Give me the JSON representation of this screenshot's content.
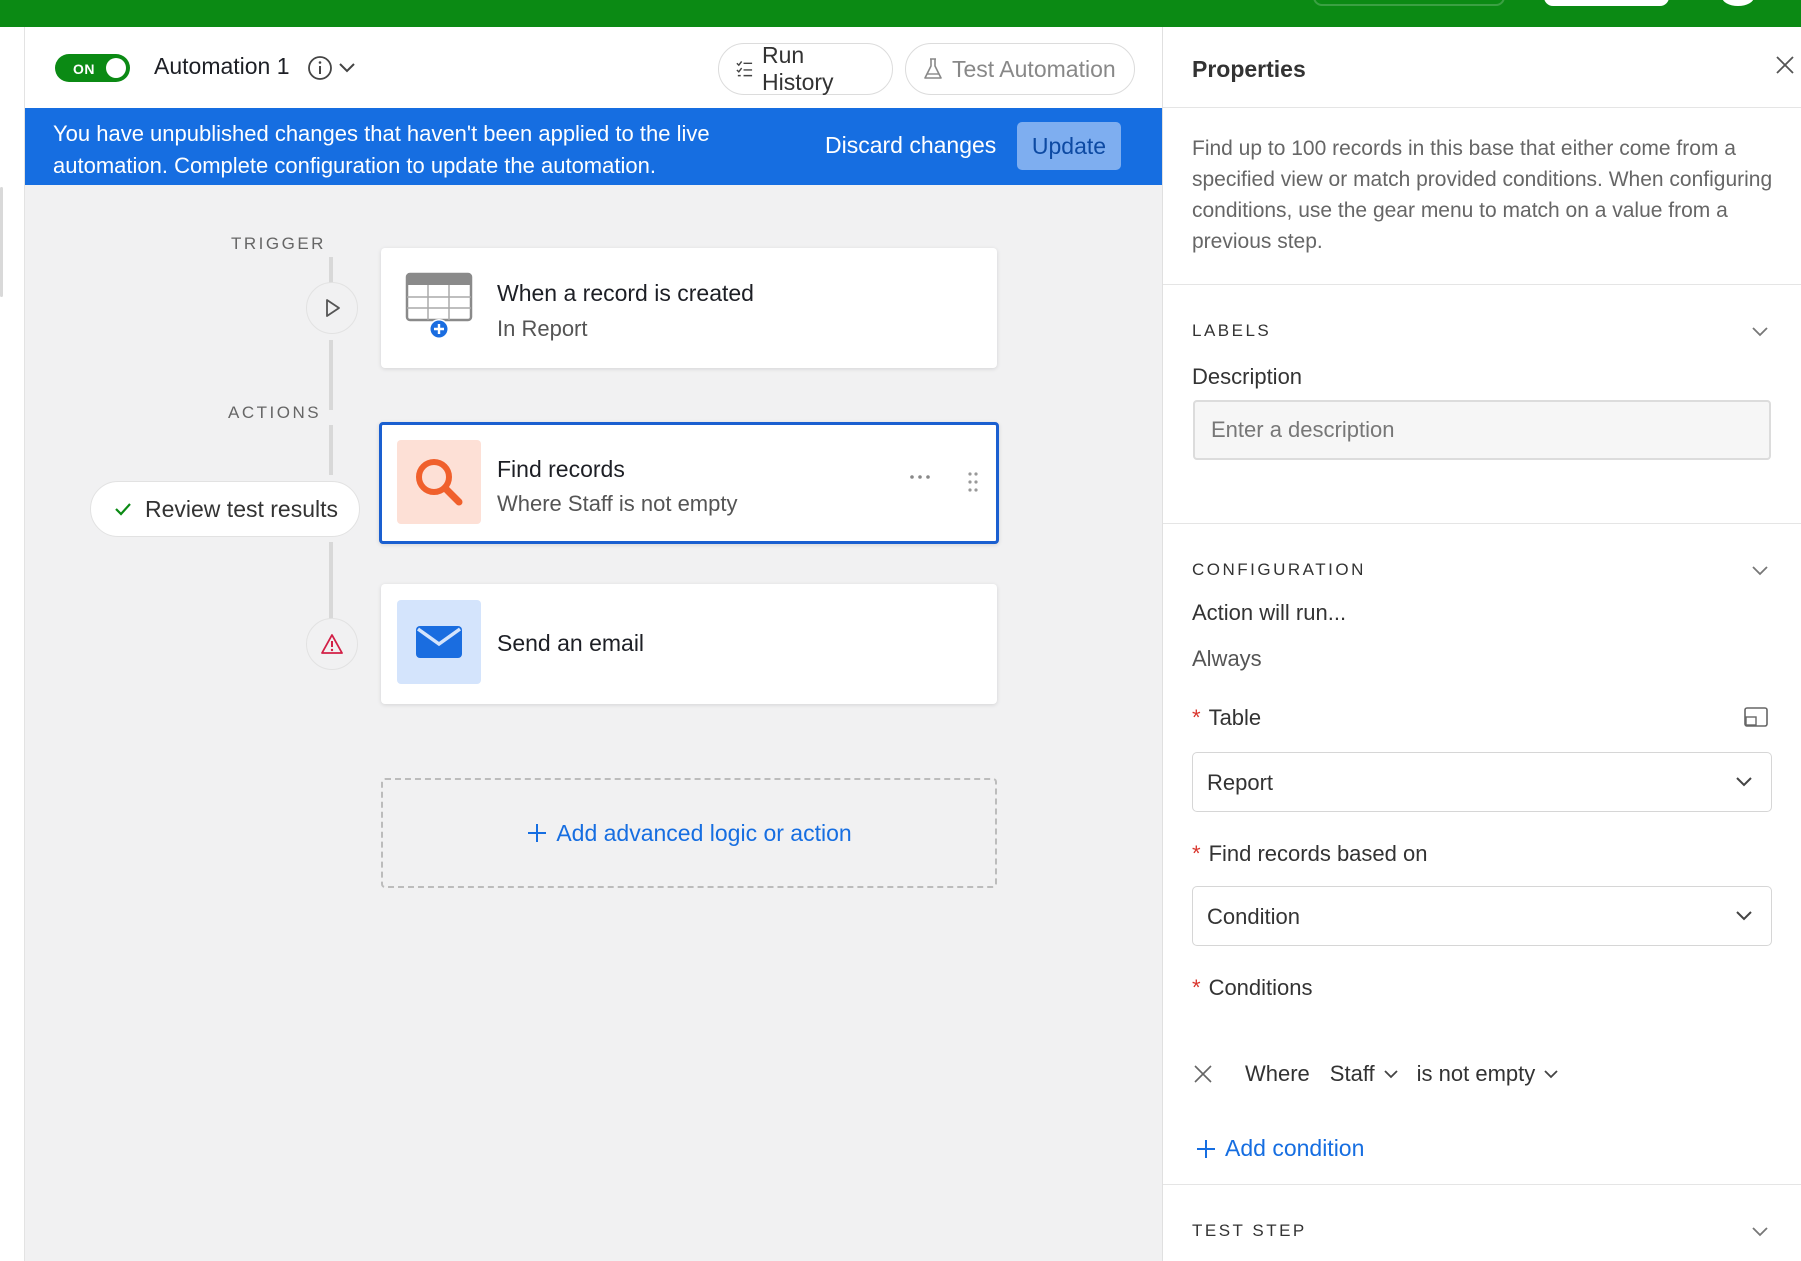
{
  "header": {
    "toggle_label": "ON",
    "automation_name": "Automation 1",
    "run_history_label": "Run History",
    "test_automation_label": "Test Automation"
  },
  "banner": {
    "message": "You have unpublished changes that haven't been applied to the live automation. Complete configuration to update the automation.",
    "discard_label": "Discard changes",
    "update_label": "Update"
  },
  "canvas": {
    "trigger_label": "TRIGGER",
    "actions_label": "ACTIONS",
    "review_label": "Review test results",
    "trigger_card": {
      "title": "When a record is created",
      "subtitle": "In Report",
      "icon": "table-plus-icon"
    },
    "find_card": {
      "title": "Find records",
      "subtitle": "Where Staff is not empty",
      "icon": "search-icon"
    },
    "email_card": {
      "title": "Send an email",
      "icon": "envelope-icon"
    },
    "add_label": "Add advanced logic or action"
  },
  "panel": {
    "title": "Properties",
    "description": "Find up to 100 records in this base that either come from a specified view or match provided conditions. When configuring conditions, use the gear menu to match on a value from a previous step.",
    "labels_section": "LABELS",
    "description_label": "Description",
    "description_placeholder": "Enter a description",
    "configuration_section": "CONFIGURATION",
    "action_will_run_label": "Action will run...",
    "action_will_run_value": "Always",
    "table_label": "Table",
    "table_value": "Report",
    "find_based_label": "Find records based on",
    "find_based_value": "Condition",
    "conditions_label": "Conditions",
    "condition": {
      "where": "Where",
      "field": "Staff",
      "operator": "is not empty"
    },
    "add_condition_label": "Add condition",
    "test_step_section": "TEST STEP"
  },
  "colors": {
    "brand_green": "#0b8a14",
    "banner_blue": "#166ee1",
    "link_blue": "#166ee1",
    "find_icon_bg": "#fde0d6",
    "find_icon_fg": "#f0602c",
    "email_icon_bg": "#d4e4fc",
    "email_icon_fg": "#1a6de0",
    "warning_red": "#d21f46"
  }
}
